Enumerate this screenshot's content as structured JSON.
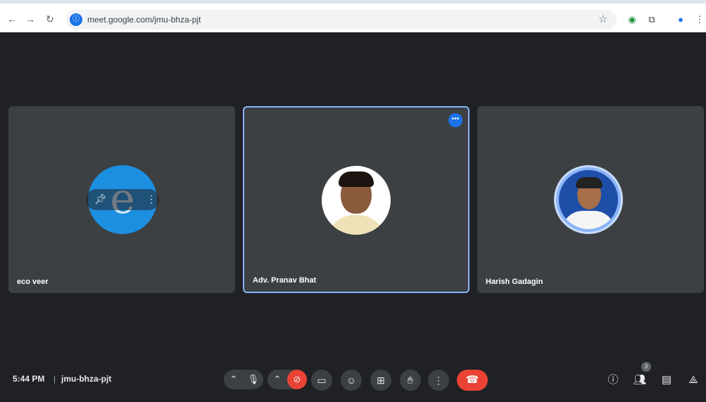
{
  "browser": {
    "url": "meet.google.com/jmu-bhza-pjt",
    "icons": [
      "back-arrow-icon",
      "forward-arrow-icon",
      "reload-icon",
      "site-info-icon",
      "bookmark-star-icon",
      "extension-icon",
      "puzzle-icon",
      "profile-avatar-icon",
      "kebab-menu-icon"
    ]
  },
  "participants": [
    {
      "name": "eco veer",
      "avatar": "edge-logo-icon"
    },
    {
      "name": "Adv. Pranav Bhat",
      "avatar": "profile-photo",
      "active": true
    },
    {
      "name": "Harish Gadagin",
      "avatar": "profile-photo-speaking"
    }
  ],
  "meeting": {
    "time": "5:44 PM",
    "separator": "|",
    "code": "jmu-bhza-pjt",
    "people_count": "3"
  },
  "colors": {
    "background": "#202124",
    "tile": "#3c4043",
    "active_border": "#8ab4f8",
    "end_call": "#ea4335",
    "accent": "#1a73e8"
  }
}
